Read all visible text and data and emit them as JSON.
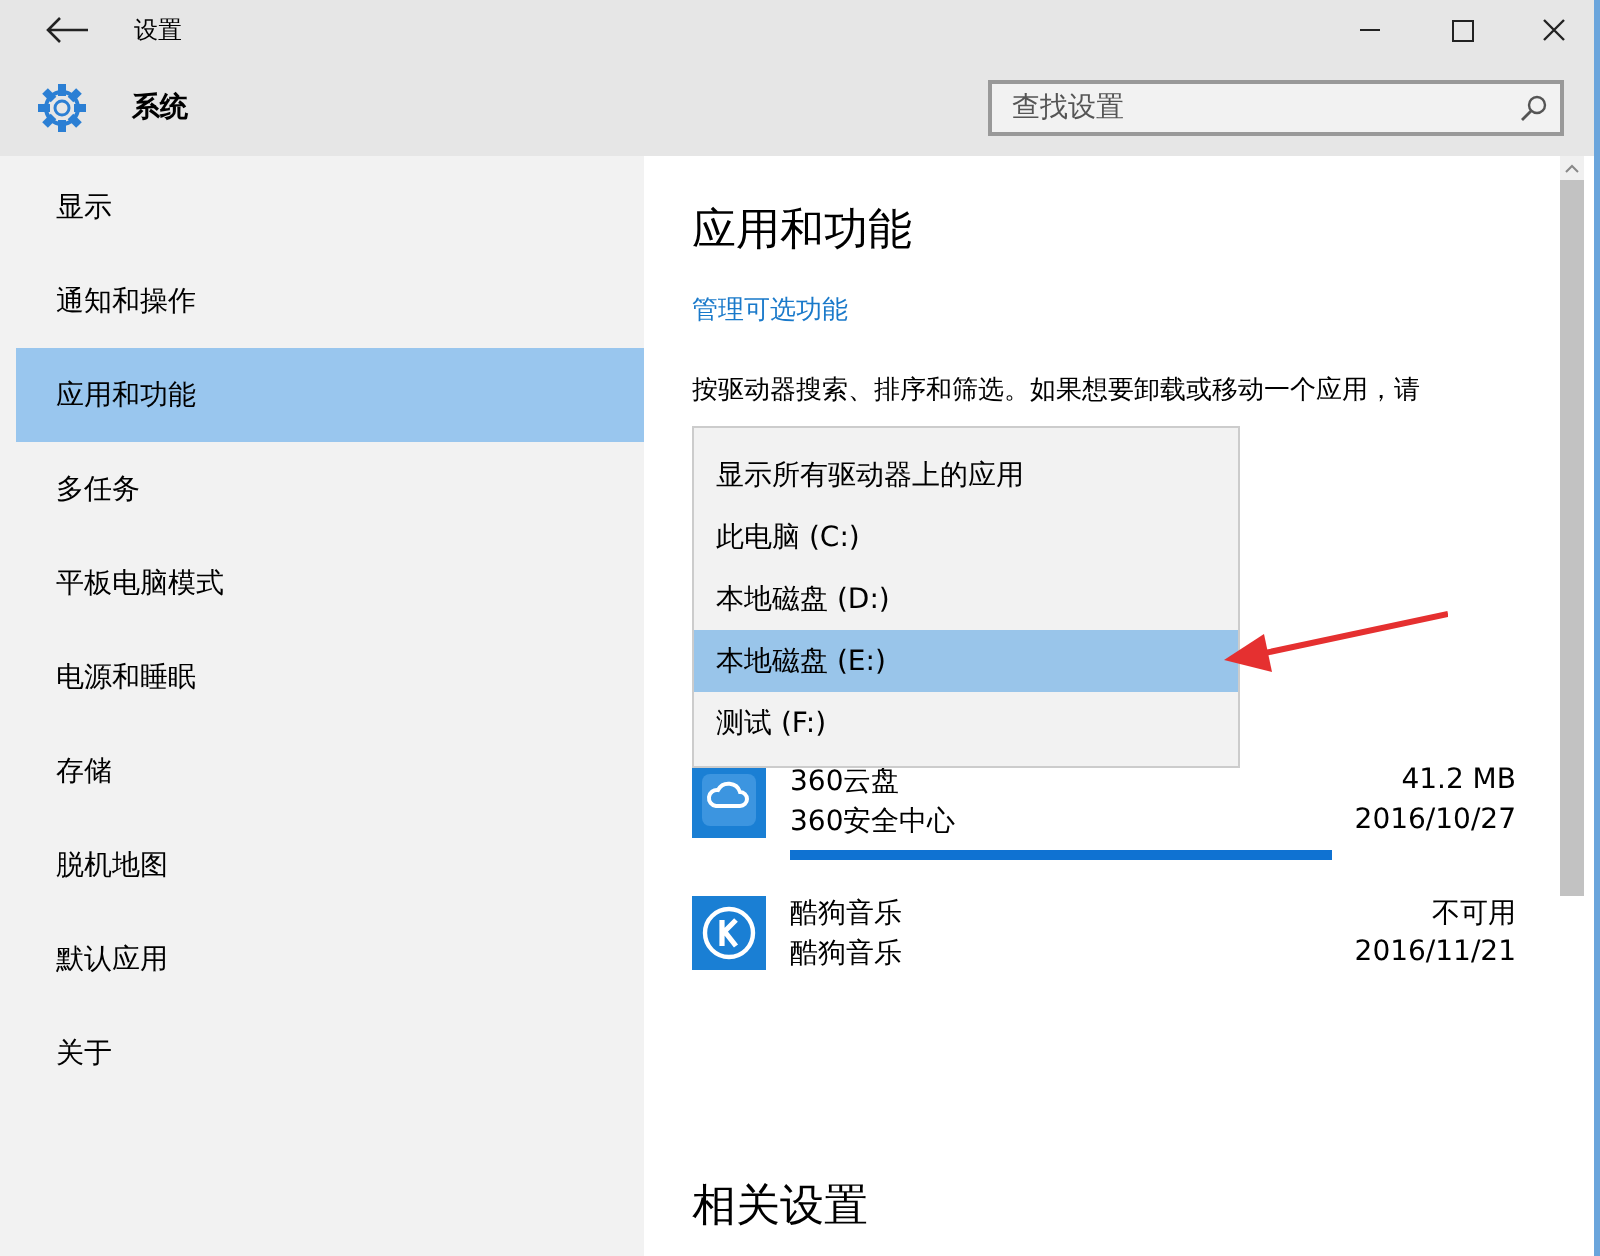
{
  "window": {
    "title": "设置"
  },
  "header": {
    "title": "系统",
    "search": {
      "placeholder": "查找设置"
    }
  },
  "sidebar": {
    "items": [
      {
        "label": "显示",
        "selected": false
      },
      {
        "label": "通知和操作",
        "selected": false
      },
      {
        "label": "应用和功能",
        "selected": true
      },
      {
        "label": "多任务",
        "selected": false
      },
      {
        "label": "平板电脑模式",
        "selected": false
      },
      {
        "label": "电源和睡眠",
        "selected": false
      },
      {
        "label": "存储",
        "selected": false
      },
      {
        "label": "脱机地图",
        "selected": false
      },
      {
        "label": "默认应用",
        "selected": false
      },
      {
        "label": "关于",
        "selected": false
      }
    ]
  },
  "content": {
    "title": "应用和功能",
    "link": "管理可选功能",
    "description": "按驱动器搜索、排序和筛选。如果想要卸载或移动一个应用，请",
    "drive_menu": [
      {
        "label": "显示所有驱动器上的应用",
        "selected": false
      },
      {
        "label": "此电脑 (C:)",
        "selected": false
      },
      {
        "label": "本地磁盘 (D:)",
        "selected": false
      },
      {
        "label": "本地磁盘 (E:)",
        "selected": true
      },
      {
        "label": "测试 (F:)",
        "selected": false
      }
    ],
    "apps": [
      {
        "kind": "cloud",
        "name": "360云盘",
        "publisher": "360安全中心",
        "size": "41.2 MB",
        "date": "2016/10/27",
        "busy": true
      },
      {
        "kind": "k",
        "name": "酷狗音乐",
        "publisher": "酷狗音乐",
        "size": "不可用",
        "date": "2016/11/21"
      }
    ],
    "related_title": "相关设置"
  }
}
